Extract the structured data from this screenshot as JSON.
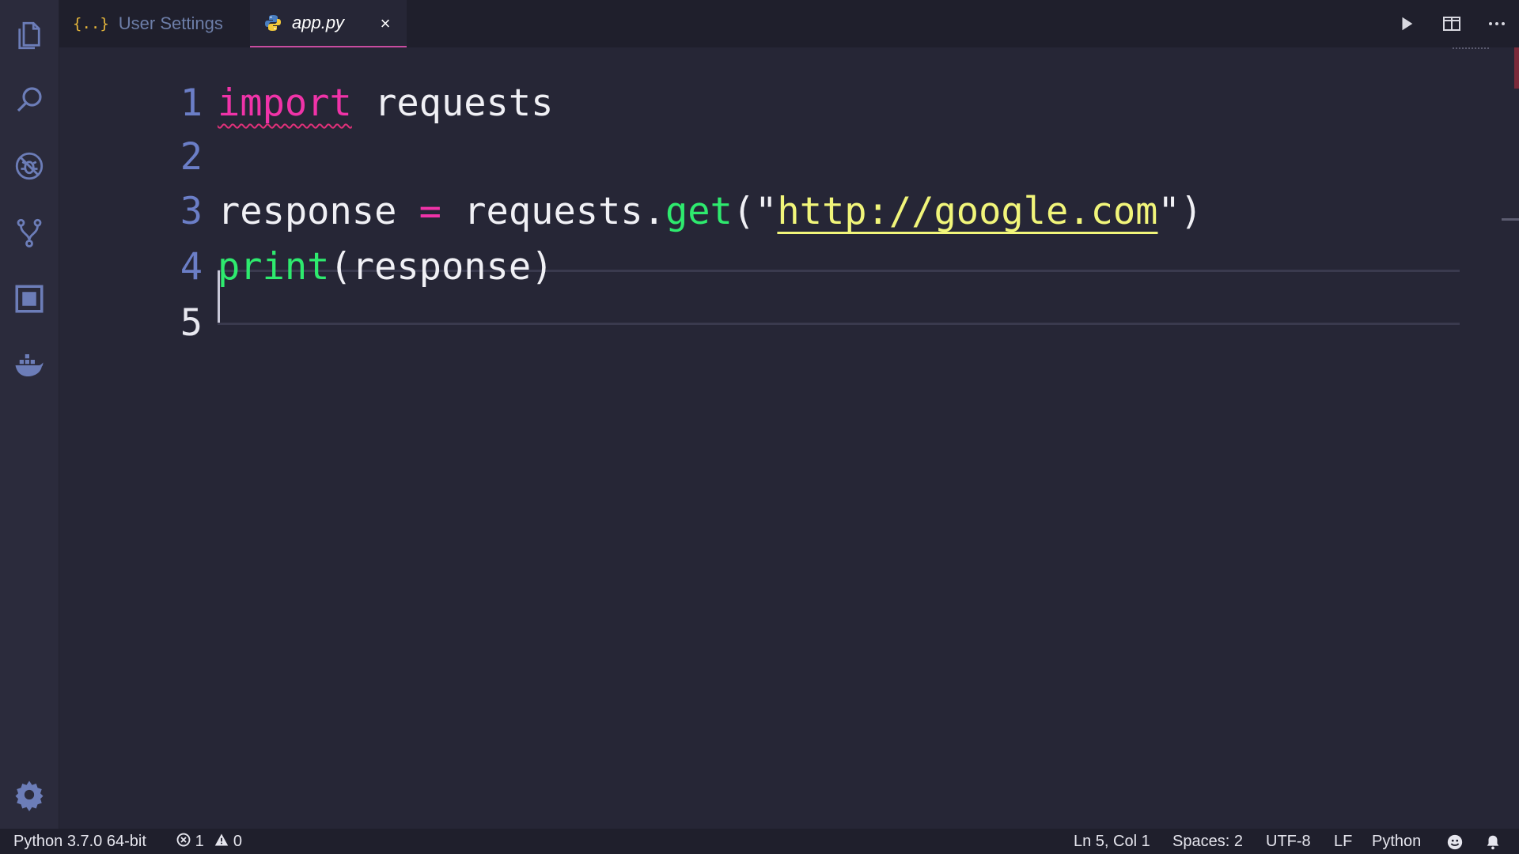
{
  "tabs": [
    {
      "label": "User Settings",
      "icon": "json-braces-icon",
      "active": false
    },
    {
      "label": "app.py",
      "icon": "python-icon",
      "active": true
    }
  ],
  "tab_bar": {
    "braces_glyph": "{..}",
    "close_glyph": "×",
    "actions": [
      "run-icon",
      "split-editor-icon",
      "more-actions-icon"
    ]
  },
  "activity_bar": {
    "items": [
      "explorer-icon",
      "search-icon",
      "debug-icon",
      "source-control-icon",
      "extensions-icon",
      "docker-icon"
    ],
    "bottom": "settings-gear-icon"
  },
  "editor": {
    "lines": [
      {
        "number": "1",
        "tokens": [
          {
            "t": "import",
            "c": "kw",
            "squiggle": true
          },
          {
            "t": " requests",
            "c": "plain"
          }
        ]
      },
      {
        "number": "2",
        "tokens": []
      },
      {
        "number": "3",
        "tokens": [
          {
            "t": "response ",
            "c": "plain"
          },
          {
            "t": "=",
            "c": "op"
          },
          {
            "t": " requests.",
            "c": "plain"
          },
          {
            "t": "get",
            "c": "fn"
          },
          {
            "t": "(\"",
            "c": "plain"
          },
          {
            "t": "http://google.com",
            "c": "str",
            "link": true
          },
          {
            "t": "\")",
            "c": "plain"
          }
        ]
      },
      {
        "number": "4",
        "tokens": [
          {
            "t": "print",
            "c": "fn"
          },
          {
            "t": "(response)",
            "c": "plain"
          }
        ]
      },
      {
        "number": "5",
        "tokens": [],
        "current": true
      }
    ]
  },
  "status_bar": {
    "interpreter": "Python 3.7.0 64-bit",
    "errors": "1",
    "warnings": "0",
    "position": "Ln 5, Col 1",
    "spaces": "Spaces: 2",
    "encoding": "UTF-8",
    "eol": "LF",
    "language": "Python"
  },
  "colors": {
    "keyword": "#f033a8",
    "function": "#2eea6e",
    "string": "#f1f57a",
    "line_number": "#6b7ec7",
    "background": "#262636",
    "accent_tab": "#c84ca0"
  }
}
